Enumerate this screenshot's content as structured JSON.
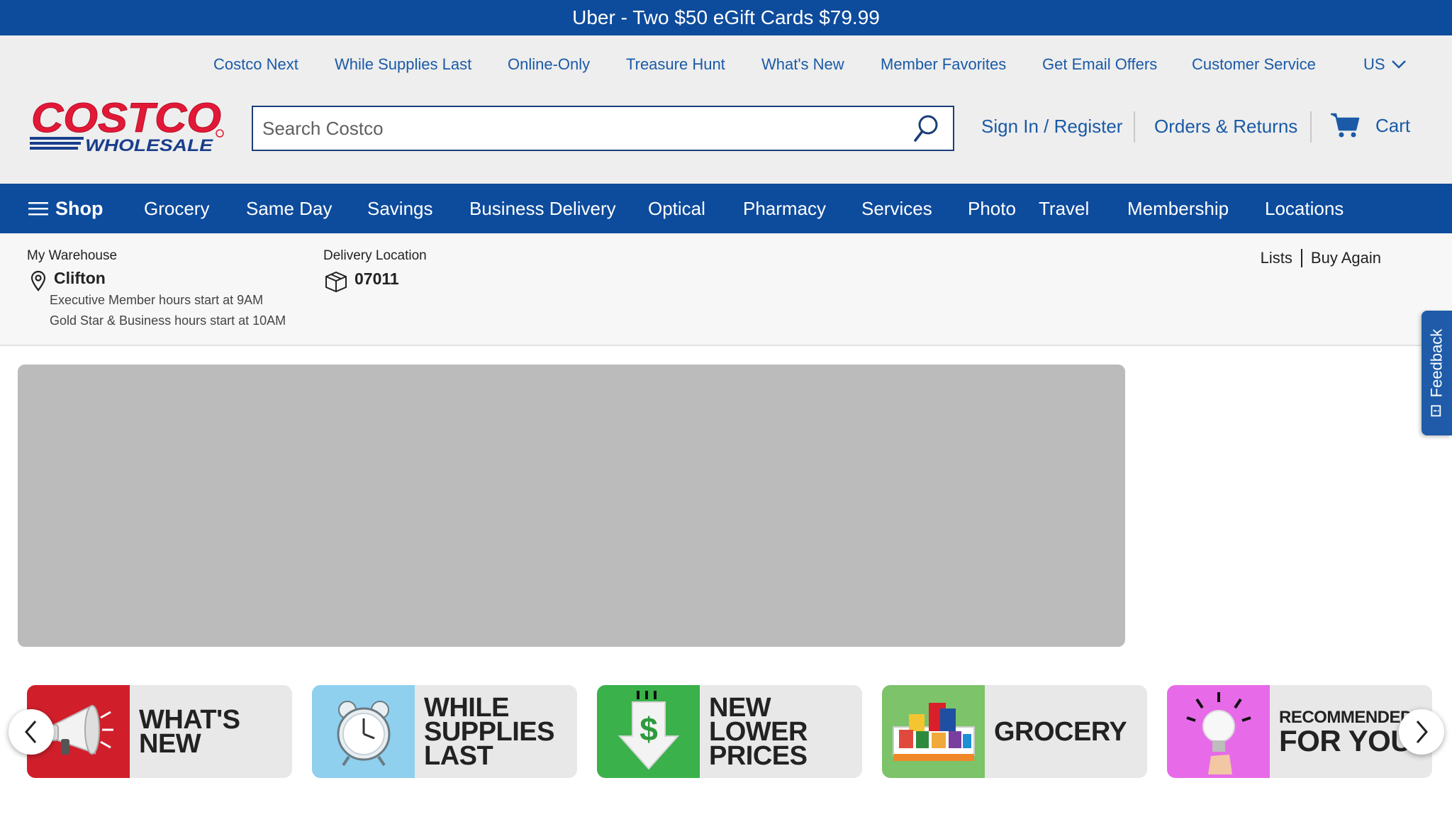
{
  "promo": {
    "text": "Uber - Two $50 eGift Cards $79.99"
  },
  "util_nav": {
    "items": [
      "Costco Next",
      "While Supplies Last",
      "Online-Only",
      "Treasure Hunt",
      "What's New",
      "Member Favorites",
      "Get Email Offers",
      "Customer Service"
    ],
    "region": "US"
  },
  "logo": {
    "top": "COSTCO",
    "bottom": "WHOLESALE"
  },
  "search": {
    "placeholder": "Search Costco",
    "value": ""
  },
  "account": {
    "sign_in": "Sign In / Register",
    "orders": "Orders & Returns",
    "cart": "Cart"
  },
  "main_nav": {
    "shop": "Shop",
    "items": [
      "Grocery",
      "Same Day",
      "Savings",
      "Business Delivery",
      "Optical",
      "Pharmacy",
      "Services",
      "Photo",
      "Travel",
      "Membership",
      "Locations"
    ]
  },
  "warehouse": {
    "label": "My Warehouse",
    "name": "Clifton",
    "note1": "Executive Member hours start at 9AM",
    "note2": "Gold Star & Business hours start at 10AM"
  },
  "delivery": {
    "label": "Delivery Location",
    "zip": "07011"
  },
  "quick_links": {
    "lists": "Lists",
    "buy_again": "Buy Again"
  },
  "feedback": {
    "label": "Feedback"
  },
  "categories": [
    {
      "title": "WHAT'S\nNEW",
      "icon": "megaphone-icon",
      "bg": "#d01f2b"
    },
    {
      "title": "WHILE\nSUPPLIES\nLAST",
      "icon": "alarm-clock-icon",
      "bg": "#8fd0ef"
    },
    {
      "title": "NEW\nLOWER\nPRICES",
      "icon": "price-drop-icon",
      "bg": "#3ab14a"
    },
    {
      "title": "GROCERY",
      "icon": "grocery-box-icon",
      "bg": "#7cc36a"
    },
    {
      "title_line1": "RECOMMENDED",
      "title_line2": "FOR YOU",
      "icon": "lightbulb-icon",
      "bg": "#e76be8"
    }
  ],
  "colors": {
    "brand_blue": "#0d4b9c",
    "link_blue": "#1a5aa6",
    "logo_red": "#e31837"
  }
}
